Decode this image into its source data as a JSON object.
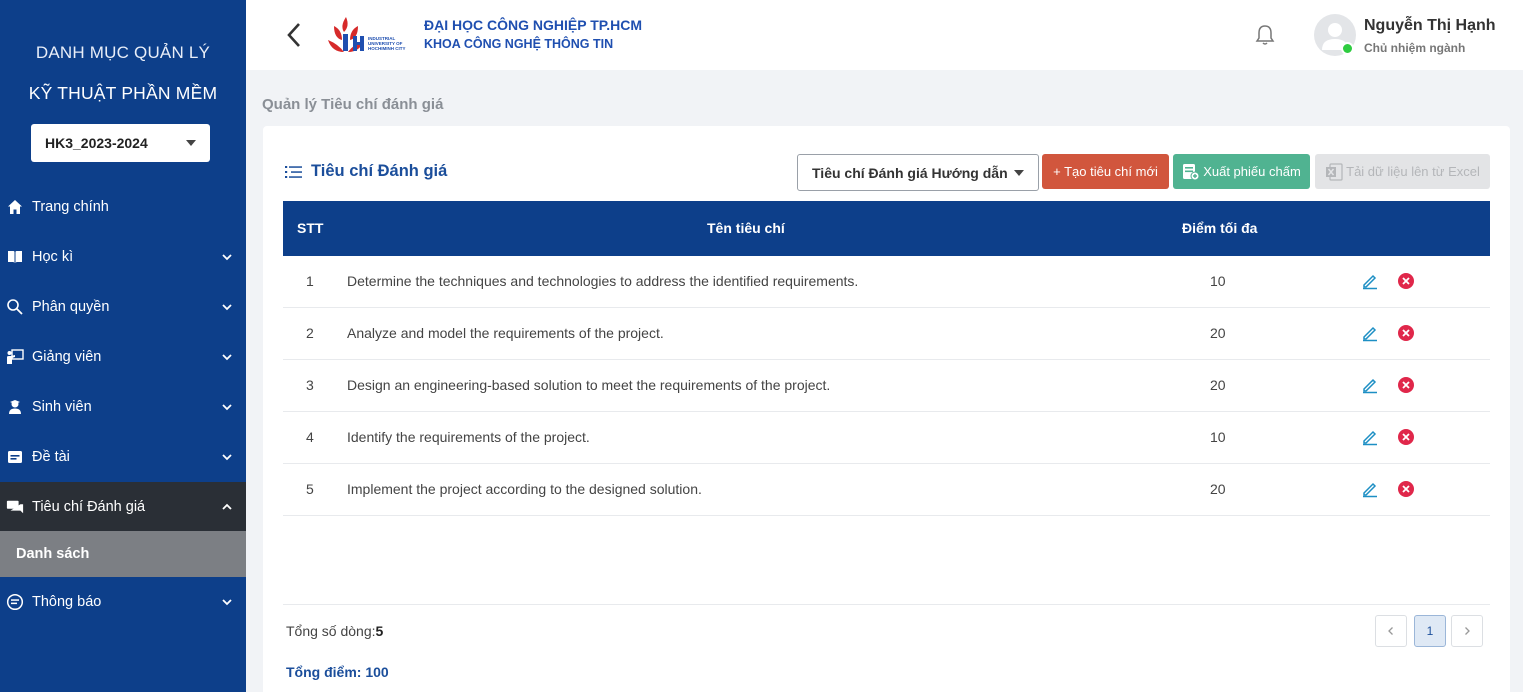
{
  "sidebar": {
    "title_line1": "DANH MỤC QUẢN LÝ",
    "title_line2": "KỸ THUẬT PHẦN MỀM",
    "semester_select": "HK3_2023-2024",
    "items": [
      {
        "label": "Trang chính",
        "icon": "home-icon"
      },
      {
        "label": "Học kì",
        "icon": "book-icon"
      },
      {
        "label": "Phân quyền",
        "icon": "user-search-icon"
      },
      {
        "label": "Giảng viên",
        "icon": "teacher-icon"
      },
      {
        "label": "Sinh viên",
        "icon": "student-icon"
      },
      {
        "label": "Đề tài",
        "icon": "topic-icon"
      },
      {
        "label": "Tiêu chí Đánh giá",
        "icon": "chat-icon"
      },
      {
        "label": "Thông báo",
        "icon": "message-icon"
      }
    ],
    "sub_item": "Danh sách",
    "active_bg": "#2a2f36"
  },
  "header": {
    "university": "ĐẠI HỌC CÔNG NGHIỆP TP.HCM",
    "faculty": "KHOA CÔNG NGHỆ THÔNG TIN",
    "logo_text": "INDUSTRIAL UNIVERSITY OF HOCHIMINH CITY",
    "user_name": "Nguyễn Thị Hạnh",
    "user_role": "Chủ nhiệm ngành"
  },
  "page": {
    "breadcrumb": "Quản lý Tiêu chí đánh giá",
    "card_title": "Tiêu chí Đánh giá",
    "filter_select": "Tiêu chí Đánh giá Hướng dẫn",
    "btn_create": "+ Tạo tiêu chí mới",
    "btn_export": "Xuất phiếu chấm",
    "btn_import": "Tải dữ liệu lên từ Excel"
  },
  "table": {
    "headers": {
      "stt": "STT",
      "name": "Tên tiêu chí",
      "score": "Điểm tối đa"
    },
    "rows": [
      {
        "stt": "1",
        "name": "Determine the techniques and technologies to address the identified requirements.",
        "score": "10"
      },
      {
        "stt": "2",
        "name": "Analyze and model the requirements of the project.",
        "score": "20"
      },
      {
        "stt": "3",
        "name": "Design an engineering-based solution to meet the requirements of the project.",
        "score": "20"
      },
      {
        "stt": "4",
        "name": "Identify the requirements of the project.",
        "score": "10"
      },
      {
        "stt": "5",
        "name": "Implement the project according to the designed solution.",
        "score": "20"
      }
    ]
  },
  "footer": {
    "total_rows_label": "Tổng số dòng:",
    "total_rows_value": "5",
    "total_score": "Tổng điểm: 100",
    "current_page": "1"
  },
  "colors": {
    "primary": "#0d3f8a",
    "create": "#d1563d",
    "export": "#50b391",
    "delete": "#e0274a",
    "edit": "#1d8fc4"
  }
}
